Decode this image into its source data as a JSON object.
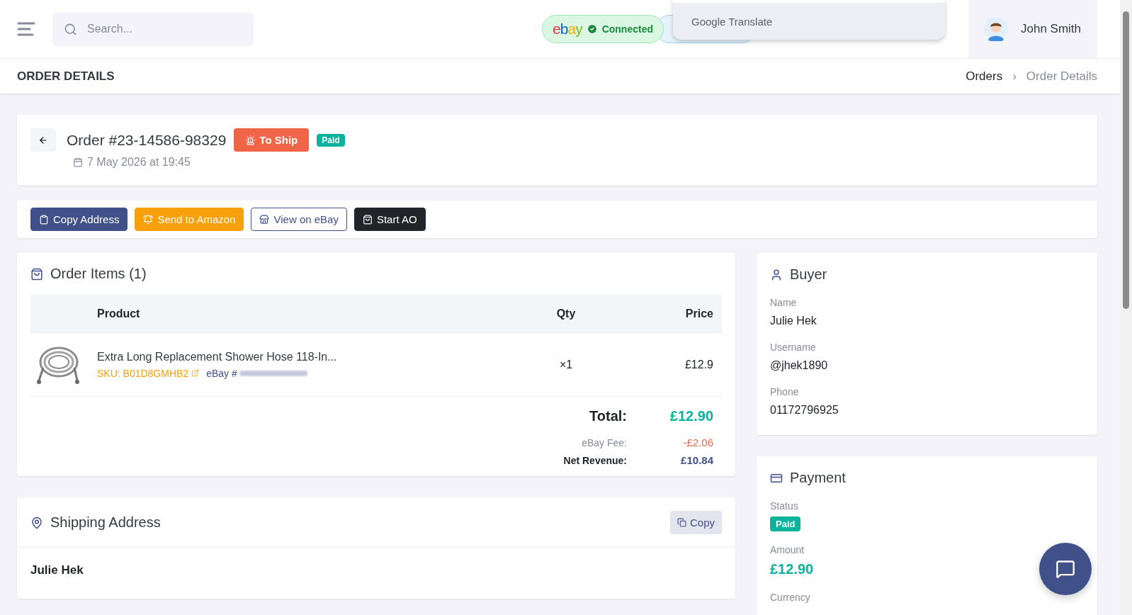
{
  "header": {
    "search": {
      "placeholder": "Search..."
    },
    "ebay_status": {
      "logo": "ebay",
      "label": "Connected"
    },
    "translate_popup": {
      "label": "Google Translate"
    },
    "user": {
      "name": "John Smith"
    }
  },
  "title_bar": {
    "title": "ORDER DETAILS",
    "breadcrumb": [
      {
        "label": "Orders",
        "selected": false
      },
      {
        "label": "›",
        "kind": "separator"
      },
      {
        "label": "Order Details",
        "selected": true
      }
    ]
  },
  "order": {
    "number": "Order #23-14586-98329",
    "status": "To Ship",
    "payment_badge": "Paid",
    "date": "7 May 2026 at 19:45"
  },
  "actions": [
    {
      "label": "Copy Address",
      "kind": "primary"
    },
    {
      "label": "Send to Amazon",
      "kind": "warning"
    },
    {
      "label": "View on eBay",
      "kind": "outline"
    },
    {
      "label": "Start AO",
      "kind": "dark"
    }
  ],
  "order_items": {
    "title": "Order Items (1)",
    "columns": [
      "Product",
      "Qty",
      "Price"
    ],
    "rows": [
      {
        "name": "Extra Long Replacement Shower Hose 118-In...",
        "sku": "SKU: B01D8GMHB2",
        "ebay_ref": "eBay #",
        "qty": "×1",
        "price": "£12.9"
      }
    ],
    "total_label": "Total:",
    "total": "£12.90",
    "fee_label": "eBay Fee:",
    "fee": "-£2.06",
    "net_label": "Net Revenue:",
    "net": "£10.84"
  },
  "shipping": {
    "title": "Shipping Address",
    "copy": "Copy",
    "name": "Julie Hek"
  },
  "buyer": {
    "title": "Buyer",
    "fields": [
      {
        "label": "Name",
        "value": "Julie Hek"
      },
      {
        "label": "Username",
        "value": "@jhek1890"
      },
      {
        "label": "Phone",
        "value": "01172796925"
      }
    ]
  },
  "payment": {
    "title": "Payment",
    "status_label": "Status",
    "status": "Paid",
    "amount_label": "Amount",
    "amount": "£12.90",
    "currency_label": "Currency"
  }
}
